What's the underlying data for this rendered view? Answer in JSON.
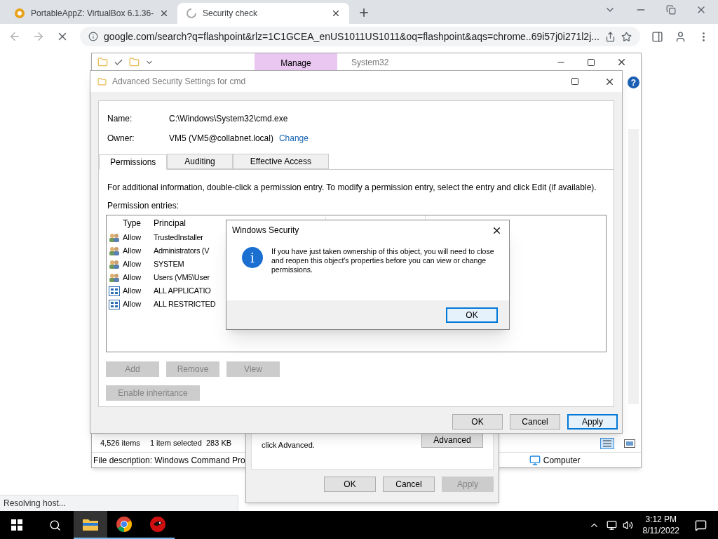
{
  "browser": {
    "tabs": [
      {
        "title": "PortableAppZ: VirtualBox 6.1.36-",
        "selected": false,
        "kind": "site"
      },
      {
        "title": "Security check",
        "selected": true,
        "kind": "loading"
      }
    ],
    "address": "google.com/search?q=flashpoint&rlz=1C1GCEA_enUS1011US1011&oq=flashpoint&aqs=chrome..69i57j0i271l2j...",
    "status": "Resolving host..."
  },
  "explorer": {
    "help_glyph": "?",
    "ribbon_tab": "Manage",
    "title": "System32",
    "items_count": "4,526 items",
    "selection": "1 item selected  283 KB",
    "description": "File description: Windows Command Pro",
    "location": "Computer"
  },
  "properties": {
    "hint": "click Advanced.",
    "advanced_button": "Advanced",
    "buttons": [
      {
        "label": "OK",
        "disabled": false
      },
      {
        "label": "Cancel",
        "disabled": false
      },
      {
        "label": "Apply",
        "disabled": true
      }
    ]
  },
  "advanced": {
    "title": "Advanced Security Settings for cmd",
    "name_label": "Name:",
    "name": "C:\\Windows\\System32\\cmd.exe",
    "owner_label": "Owner:",
    "owner": "VM5 (VM5@collabnet.local)",
    "change_link": "Change",
    "tabs": [
      {
        "label": "Permissions",
        "selected": true
      },
      {
        "label": "Auditing",
        "selected": false
      },
      {
        "label": "Effective Access",
        "selected": false
      }
    ],
    "info": "For additional information, double-click a permission entry. To modify a permission entry, select the entry and click Edit (if available).",
    "entries_label": "Permission entries:",
    "columns": [
      "Type",
      "Principal"
    ],
    "entries": [
      {
        "kind": "users",
        "type": "Allow",
        "principal": "TrustedInstaller"
      },
      {
        "kind": "users",
        "type": "Allow",
        "principal": "Administrators (V"
      },
      {
        "kind": "users",
        "type": "Allow",
        "principal": "SYSTEM"
      },
      {
        "kind": "users",
        "type": "Allow",
        "principal": "Users (VM5\\User"
      },
      {
        "kind": "package",
        "type": "Allow",
        "principal": "ALL APPLICATIO"
      },
      {
        "kind": "package",
        "type": "Allow",
        "principal": "ALL RESTRICTED"
      }
    ],
    "entry_buttons": [
      {
        "label": "Add",
        "disabled": true
      },
      {
        "label": "Remove",
        "disabled": true
      },
      {
        "label": "View",
        "disabled": true
      }
    ],
    "inheritance_button": {
      "label": "Enable inheritance",
      "disabled": true
    },
    "buttons": [
      {
        "label": "OK",
        "focused": false
      },
      {
        "label": "Cancel",
        "focused": false
      },
      {
        "label": "Apply",
        "focused": true
      }
    ]
  },
  "message": {
    "title": "Windows Security",
    "icon_glyph": "i",
    "text": "If you have just taken ownership of this object, you will need to close and reopen this object's properties before you can view or change permissions.",
    "button": {
      "label": "OK",
      "focused": true
    }
  },
  "taskbar": {
    "apps": [
      {
        "kind": "explorer",
        "active": true
      },
      {
        "kind": "chrome",
        "active": false
      },
      {
        "kind": "red",
        "active": false
      }
    ],
    "time": "3:12 PM",
    "date": "8/11/2022"
  }
}
